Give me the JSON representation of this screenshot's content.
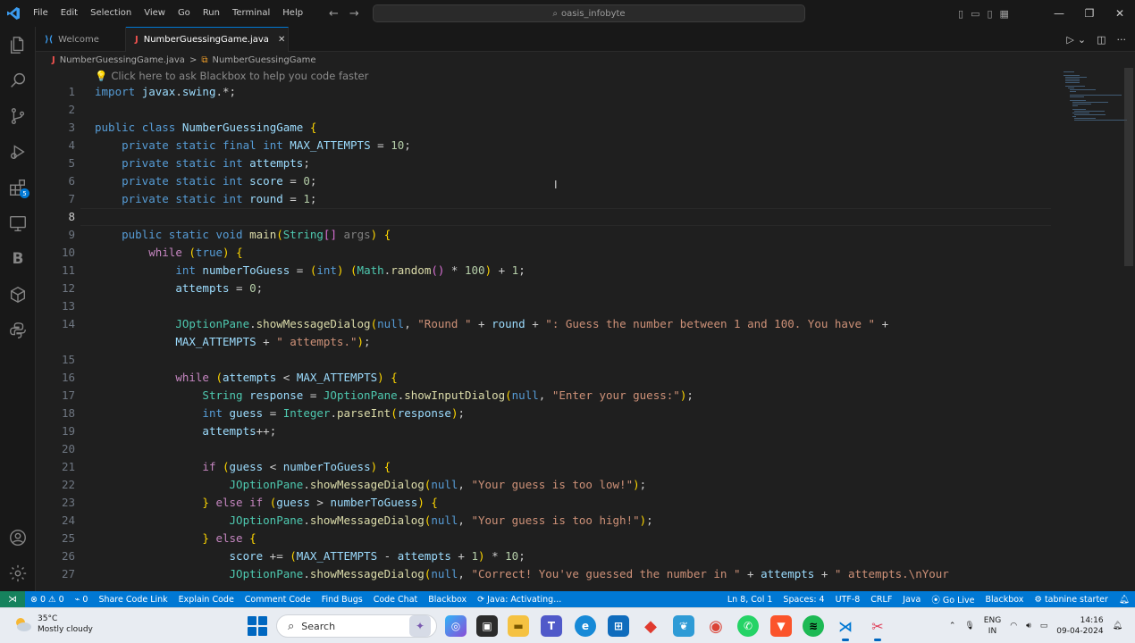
{
  "titlebar": {
    "menu": [
      "File",
      "Edit",
      "Selection",
      "View",
      "Go",
      "Run",
      "Terminal",
      "Help"
    ],
    "search_text": "oasis_infobyte"
  },
  "tabs": [
    {
      "label": "Welcome",
      "active": false
    },
    {
      "label": "NumberGuessingGame.java",
      "active": true
    }
  ],
  "breadcrumb": {
    "file": "NumberGuessingGame.java",
    "separator": ">",
    "symbol": "NumberGuessingGame"
  },
  "editor": {
    "hint": "Click here to ask Blackbox to help you code faster",
    "current_line": 8,
    "line_numbers": [
      "1",
      "2",
      "3",
      "4",
      "5",
      "6",
      "7",
      "8",
      "9",
      "10",
      "11",
      "12",
      "13",
      "14",
      "15",
      "16",
      "17",
      "18",
      "19",
      "20",
      "21",
      "22",
      "23",
      "24",
      "25",
      "26",
      "27"
    ],
    "code_lines": [
      "import javax.swing.*;",
      "",
      "public class NumberGuessingGame {",
      "    private static final int MAX_ATTEMPTS = 10;",
      "    private static int attempts;",
      "    private static int score = 0;",
      "    private static int round = 1;",
      "",
      "    public static void main(String[] args) {",
      "        while (true) {",
      "            int numberToGuess = (int) (Math.random() * 100) + 1;",
      "            attempts = 0;",
      "",
      "            JOptionPane.showMessageDialog(null, \"Round \" + round + \": Guess the number between 1 and 100. You have \" +",
      "            MAX_ATTEMPTS + \" attempts.\");",
      "",
      "            while (attempts < MAX_ATTEMPTS) {",
      "                String response = JOptionPane.showInputDialog(null, \"Enter your guess:\");",
      "                int guess = Integer.parseInt(response);",
      "                attempts++;",
      "",
      "                if (guess < numberToGuess) {",
      "                    JOptionPane.showMessageDialog(null, \"Your guess is too low!\");",
      "                } else if (guess > numberToGuess) {",
      "                    JOptionPane.showMessageDialog(null, \"Your guess is too high!\");",
      "                } else {",
      "                    score += (MAX_ATTEMPTS - attempts + 1) * 10;",
      "                    JOptionPane.showMessageDialog(null, \"Correct! You've guessed the number in \" + attempts + \" attempts.\\nYour"
    ]
  },
  "statusbar": {
    "errors": "0",
    "warnings": "0",
    "ports": "0",
    "left_items": [
      "Share Code Link",
      "Explain Code",
      "Comment Code",
      "Find Bugs",
      "Code Chat",
      "Blackbox"
    ],
    "java_status": "Java: Activating...",
    "cursor_pos": "Ln 8, Col 1",
    "spaces": "Spaces: 4",
    "encoding": "UTF-8",
    "eol": "CRLF",
    "language": "Java",
    "go_live": "Go Live",
    "blackbox": "Blackbox",
    "tabnine": "tabnine starter"
  },
  "taskbar": {
    "weather_temp": "35°C",
    "weather_desc": "Mostly cloudy",
    "search_label": "Search",
    "lang_top": "ENG",
    "lang_bottom": "IN",
    "time": "14:16",
    "date": "09-04-2024"
  },
  "colors": {
    "accent": "#0078d4",
    "editor_bg": "#1f1f1f",
    "remote": "#16825d"
  }
}
